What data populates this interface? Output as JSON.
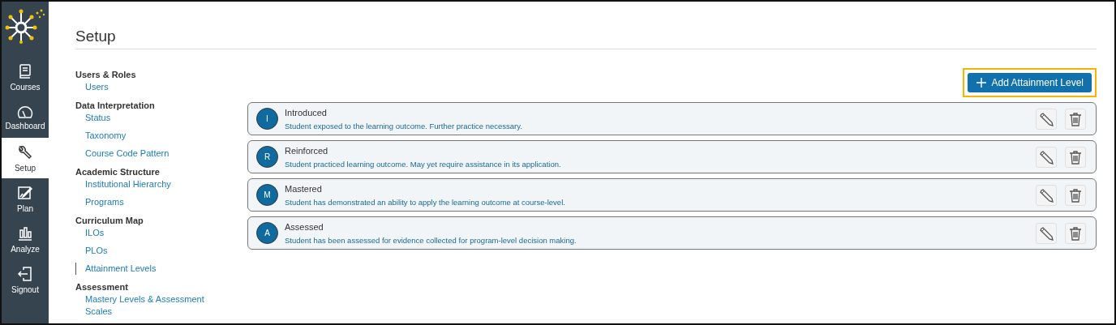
{
  "sidebar": {
    "items": [
      {
        "label": "Courses",
        "kind": "book",
        "selected": false
      },
      {
        "label": "Dashboard",
        "kind": "gauge",
        "selected": false
      },
      {
        "label": "Setup",
        "kind": "wrench",
        "selected": true
      },
      {
        "label": "Plan",
        "kind": "edit",
        "selected": false
      },
      {
        "label": "Analyze",
        "kind": "bars",
        "selected": false
      },
      {
        "label": "Signout",
        "kind": "exit",
        "selected": false
      }
    ]
  },
  "page": {
    "title": "Setup"
  },
  "settings_nav": {
    "groups": [
      {
        "heading": "Users & Roles",
        "links": [
          {
            "label": "Users",
            "selected": false
          }
        ]
      },
      {
        "heading": "Data Interpretation",
        "links": [
          {
            "label": "Status",
            "selected": false
          },
          {
            "label": "Taxonomy",
            "selected": false
          },
          {
            "label": "Course Code Pattern",
            "selected": false
          }
        ]
      },
      {
        "heading": "Academic Structure",
        "links": [
          {
            "label": "Institutional Hierarchy",
            "selected": false
          },
          {
            "label": "Programs",
            "selected": false
          }
        ]
      },
      {
        "heading": "Curriculum Map",
        "links": [
          {
            "label": "ILOs",
            "selected": false
          },
          {
            "label": "PLOs",
            "selected": false
          },
          {
            "label": "Attainment Levels",
            "selected": true
          }
        ]
      },
      {
        "heading": "Assessment",
        "links": [
          {
            "label": "Mastery Levels & Assessment Scales",
            "selected": false
          }
        ]
      }
    ]
  },
  "add_button": {
    "label": "Add Attainment Level",
    "highlighted": true
  },
  "attainment_levels": [
    {
      "letter": "I",
      "name": "Introduced",
      "description": "Student exposed to the learning outcome. Further practice necessary."
    },
    {
      "letter": "R",
      "name": "Reinforced",
      "description": "Student practiced learning outcome. May yet require assistance in its application."
    },
    {
      "letter": "M",
      "name": "Mastered",
      "description": "Student has demonstrated an ability to apply the learning outcome at course-level."
    },
    {
      "letter": "A",
      "name": "Assessed",
      "description": "Student has been assessed for evidence collected for program-level decision making."
    }
  ]
}
